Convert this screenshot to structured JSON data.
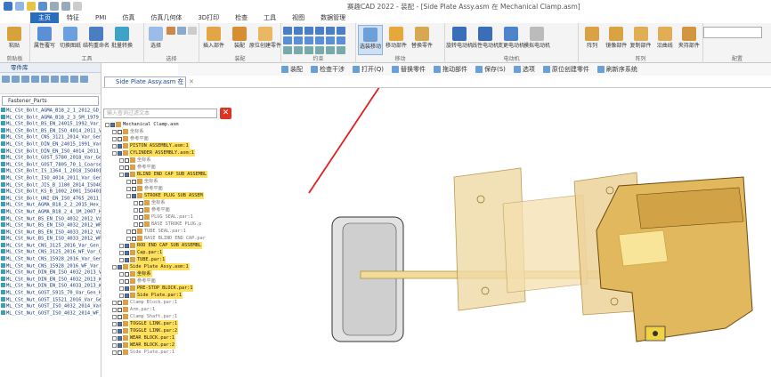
{
  "window": {
    "title": "赛趣CAD 2022 - 装配 - [Side Plate Assy.asm 在 Mechanical Clamp.asm]"
  },
  "menu_tabs": [
    "主页",
    "特征",
    "PMI",
    "仿真",
    "仿真几何体",
    "3D打印",
    "检查",
    "工具",
    "视图",
    "数据管理"
  ],
  "ribbon": {
    "groups": [
      {
        "label": "剪贴板",
        "buttons": [
          "粘贴"
        ]
      },
      {
        "label": "工具",
        "buttons": [
          "属性覆写",
          "切换图纸",
          "结构重命名",
          "批量转换"
        ]
      },
      {
        "label": "选择",
        "buttons": [
          "选择"
        ]
      },
      {
        "label": "装配",
        "buttons": [
          "插入部件",
          "装配",
          "原位创建零件"
        ]
      },
      {
        "label": "约束",
        "buttons": []
      },
      {
        "label": "移动",
        "buttons": [
          "选装移动",
          "移动部件",
          "替换零件"
        ]
      },
      {
        "label": "电动机",
        "buttons": [
          "旋转电动机",
          "线性电动机",
          "变更电动机",
          "模拟电动机"
        ]
      },
      {
        "label": "阵列",
        "buttons": [
          "阵列",
          "镜像部件",
          "复制部件",
          "沿曲线",
          "夹持部件"
        ]
      },
      {
        "label": "配置",
        "buttons": []
      }
    ]
  },
  "subbar": [
    "装配",
    "检查干涉",
    "打开(Q)",
    "替换零件",
    "拖动部件",
    "保存(S)",
    "选项",
    "原位创建零件",
    "刷新序系统"
  ],
  "left_panel": {
    "header": "零件库",
    "folder": "Fastener_Parts",
    "items": [
      "ML_CSt_Bolt_AGMA_B18_2_1_2012_GD_T",
      "ML_CSt_Bolt_AGMA_B18_2_3_5M_1979_W",
      "ML_CSt_Bolt_BS_EN_24015_1992_Var_S",
      "ML_CSt_Bolt_BS_EN_ISO_4014_2011_Va",
      "ML_CSt_Bolt_CNS_3121_2014_Var_Gen",
      "ML_CSt_Bolt_DIN_EN_24015_1991_Var_",
      "ML_CSt_Bolt_DIN_EN_ISO_4014_2011_V",
      "ML_CSt_Bolt_GOST_5780_2018_Var_Gen",
      "ML_CSt_Bolt_GOST_7805_70_1_Coarse_",
      "ML_CSt_Bolt_IS_1364_1_2018_ISO4014",
      "ML_CSt_Bolt_ISO_4014_2011_Var_Gen_",
      "ML_CSt_Bolt_JIS_B_1180_2014_ISO401",
      "ML_CSt_Bolt_KS_B_1002_2001_ISO4014",
      "ML_CSt_Bolt_UNI_EN_ISO_4765_2011_V",
      "ML_CSt_Nut_AGMA_B18_2_2_2015_Hex_W",
      "ML_CSt_Nut_AGMA_B18_2_4_1M_2007_Hex",
      "ML_CSt_Nut_BS_EN_ISO_4032_2012_Var",
      "ML_CSt_Nut_BS_EN_ISO_4032_2012_WF_",
      "ML_CSt_Nut_BS_EN_ISO_4033_2012_Var",
      "ML_CSt_Nut_BS_EN_ISO_4033_2012_WF_",
      "ML_CSt_Nut_CNS_3125_2016_Var_Gen_G",
      "ML_CSt_Nut_CNS_3125_2016_WF_Var_Ge",
      "ML_CSt_Nut_CNS_15928_2016_Var_Gen_",
      "ML_CSt_Nut_CNS_15928_2016_WF_Var_G",
      "ML_CSt_Nut_DIN_EN_ISO_4032_2013_Va",
      "ML_CSt_Nut_DIN_EN_ISO_4032_2013_WF",
      "ML_CSt_Nut_DIN_EN_ISO_4033_2013_WF",
      "ML_CSt_Nut_GOST_5915_70_Var_Gen_He",
      "ML_CSt_Nut_GOST_15521_2016_Var_Gen",
      "ML_CSt_Nut_GOST_ISO_4032_2014_Var_",
      "ML_CSt_Nut_GOST_ISO_4032_2014_WF_V"
    ]
  },
  "doc_tab": "Side Plate Assy.asm 在 ...",
  "tree": {
    "filter_placeholder": "输入查询过滤文本",
    "rows": [
      {
        "level": 0,
        "text": "Mechanical Clamp.asm",
        "checked": true,
        "hl": false
      },
      {
        "level": 1,
        "text": "坐标系",
        "checked": false,
        "hl": false
      },
      {
        "level": 1,
        "text": "参考平面",
        "checked": false,
        "hl": false
      },
      {
        "level": 1,
        "text": "PISTON ASSEMBLY.asm:1",
        "checked": true,
        "hl": true
      },
      {
        "level": 1,
        "text": "CYLINDER ASSEMBLY.asm:1",
        "checked": true,
        "hl": true
      },
      {
        "level": 2,
        "text": "坐标系",
        "checked": false,
        "hl": false
      },
      {
        "level": 2,
        "text": "参考平面",
        "checked": false,
        "hl": false
      },
      {
        "level": 2,
        "text": "BLIND END CAP SUB ASSEMBL",
        "checked": true,
        "hl": true
      },
      {
        "level": 3,
        "text": "坐标系",
        "checked": false,
        "hl": false
      },
      {
        "level": 3,
        "text": "参考平面",
        "checked": false,
        "hl": false
      },
      {
        "level": 3,
        "text": "STROKE PLUG SUB ASSEM",
        "checked": true,
        "hl": true
      },
      {
        "level": 4,
        "text": "坐标系",
        "checked": false,
        "hl": false
      },
      {
        "level": 4,
        "text": "参考平面",
        "checked": false,
        "hl": false
      },
      {
        "level": 4,
        "text": "PLUG SEAL.par:1",
        "checked": false,
        "hl": false
      },
      {
        "level": 4,
        "text": "BASE STROKE PLUG.p",
        "checked": false,
        "hl": false
      },
      {
        "level": 3,
        "text": "TUBE SEAL.par:1",
        "checked": false,
        "hl": false
      },
      {
        "level": 3,
        "text": "BASE BLIND END CAP.par",
        "checked": false,
        "hl": false
      },
      {
        "level": 2,
        "text": "ROD END CAP SUB ASSEMBL",
        "checked": true,
        "hl": true
      },
      {
        "level": 2,
        "text": "Cap.par:1",
        "checked": true,
        "hl": true
      },
      {
        "level": 2,
        "text": "TUBE.par:1",
        "checked": true,
        "hl": true
      },
      {
        "level": 1,
        "text": "Side Plate Assy.asm:1",
        "checked": true,
        "hl": true
      },
      {
        "level": 2,
        "text": "坐标系",
        "checked": false,
        "hl": true
      },
      {
        "level": 2,
        "text": "参考平面",
        "checked": false,
        "hl": false
      },
      {
        "level": 2,
        "text": "PRE-STOP BLOCK.par:1",
        "checked": true,
        "hl": true
      },
      {
        "level": 2,
        "text": "Side Plate.par:1",
        "checked": true,
        "hl": true
      },
      {
        "level": 1,
        "text": "Clamp Block.par:1",
        "checked": false,
        "hl": false
      },
      {
        "level": 1,
        "text": "Arm.par:1",
        "checked": false,
        "hl": false
      },
      {
        "level": 1,
        "text": "Clamp Shaft.par:1",
        "checked": false,
        "hl": false
      },
      {
        "level": 1,
        "text": "TOGGLE LINK.par:1",
        "checked": true,
        "hl": true
      },
      {
        "level": 1,
        "text": "TOGGLE LINK.par:2",
        "checked": true,
        "hl": true
      },
      {
        "level": 1,
        "text": "WEAR BLOCK.par:1",
        "checked": true,
        "hl": true
      },
      {
        "level": 1,
        "text": "WEAR BLOCK.par:2",
        "checked": true,
        "hl": true
      },
      {
        "level": 1,
        "text": "Side Plate.par:1",
        "checked": false,
        "hl": false
      }
    ]
  },
  "colors": {
    "accent": "#2a6ebb",
    "part_fill": "#e2b85e",
    "highlight": "#ffe05a",
    "arrow": "#e02020"
  }
}
